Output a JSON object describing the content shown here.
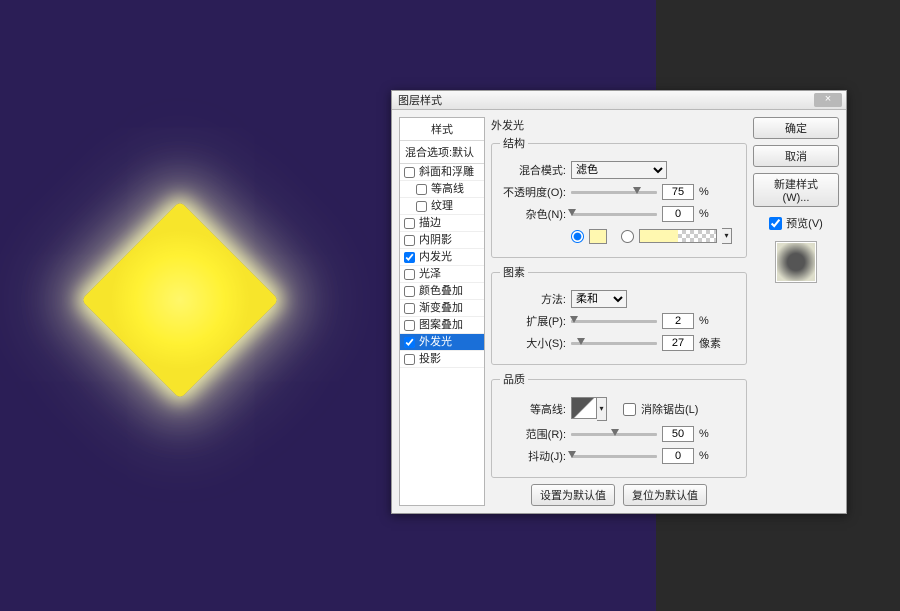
{
  "canvas": {
    "bg_color": "#2b1e56",
    "shape_color": "#fff133"
  },
  "dialog": {
    "title": "图层样式",
    "close": "×",
    "list_header": "样式",
    "list_sub": "混合选项:默认",
    "effects": [
      {
        "label": "斜面和浮雕",
        "checked": false
      },
      {
        "label": "等高线",
        "checked": false,
        "indent": true
      },
      {
        "label": "纹理",
        "checked": false,
        "indent": true
      },
      {
        "label": "描边",
        "checked": false
      },
      {
        "label": "内阴影",
        "checked": false
      },
      {
        "label": "内发光",
        "checked": true
      },
      {
        "label": "光泽",
        "checked": false
      },
      {
        "label": "颜色叠加",
        "checked": false
      },
      {
        "label": "渐变叠加",
        "checked": false
      },
      {
        "label": "图案叠加",
        "checked": false
      },
      {
        "label": "外发光",
        "checked": true,
        "selected": true
      },
      {
        "label": "投影",
        "checked": false
      }
    ],
    "section_title": "外发光",
    "structure": {
      "legend": "结构",
      "blend_label": "混合模式:",
      "blend_value": "滤色",
      "opacity_label": "不透明度(O):",
      "opacity_value": "75",
      "noise_label": "杂色(N):",
      "noise_value": "0",
      "pct": "%",
      "glow_color": "#fff8b0"
    },
    "elements": {
      "legend": "图素",
      "technique_label": "方法:",
      "technique_value": "柔和",
      "spread_label": "扩展(P):",
      "spread_value": "2",
      "size_label": "大小(S):",
      "size_value": "27",
      "pct": "%",
      "px": "像素"
    },
    "quality": {
      "legend": "品质",
      "contour_label": "等高线:",
      "antialias_label": "消除锯齿(L)",
      "range_label": "范围(R):",
      "range_value": "50",
      "jitter_label": "抖动(J):",
      "jitter_value": "0",
      "pct": "%"
    },
    "defaults_set": "设置为默认值",
    "defaults_reset": "复位为默认值",
    "ok": "确定",
    "cancel": "取消",
    "new_style": "新建样式(W)...",
    "preview": "预览(V)"
  }
}
